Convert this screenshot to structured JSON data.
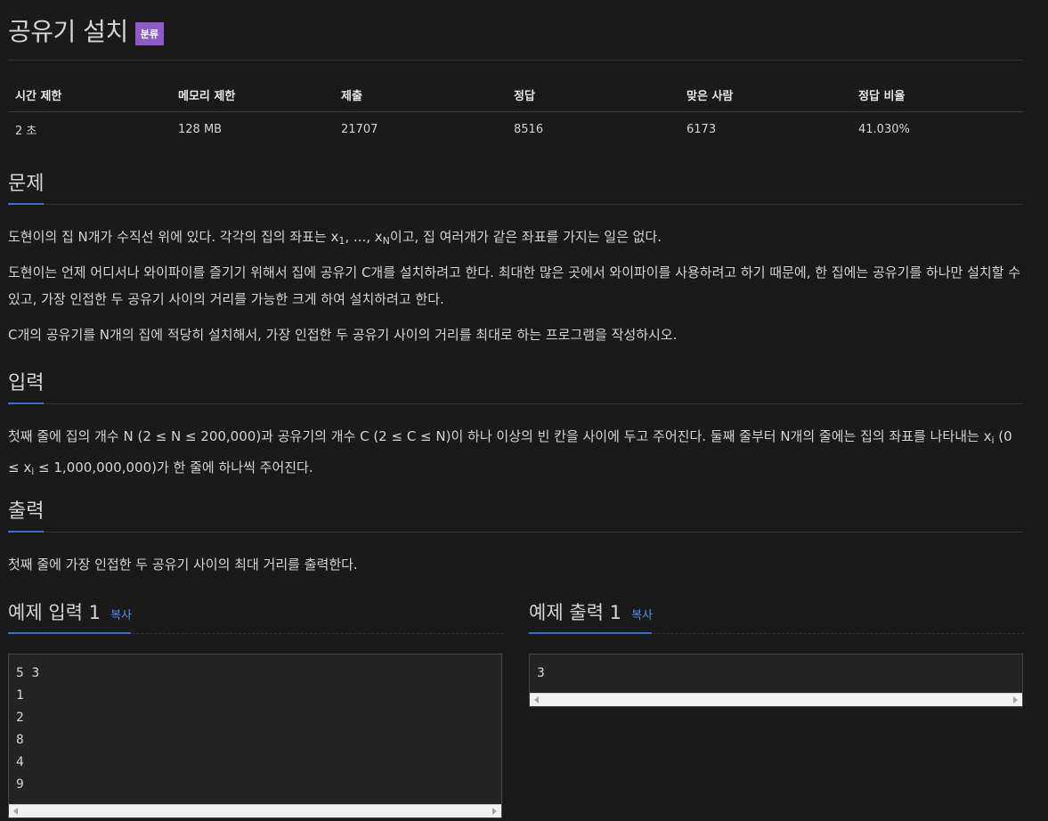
{
  "title": "공유기 설치",
  "badge": "분류",
  "info_table": {
    "headers": [
      "시간 제한",
      "메모리 제한",
      "제출",
      "정답",
      "맞은 사람",
      "정답 비율"
    ],
    "values": [
      "2 초",
      "128 MB",
      "21707",
      "8516",
      "6173",
      "41.030%"
    ]
  },
  "problem": {
    "heading": "문제",
    "p1_a": "도현이의 집 N개가 수직선 위에 있다. 각각의 집의 좌표는 x",
    "p1_sub1": "1",
    "p1_b": ", ..., x",
    "p1_sub2": "N",
    "p1_c": "이고, 집 여러개가 같은 좌표를 가지는 일은 없다.",
    "p2": "도현이는 언제 어디서나 와이파이를 즐기기 위해서 집에 공유기 C개를 설치하려고 한다. 최대한 많은 곳에서 와이파이를 사용하려고 하기 때문에, 한 집에는 공유기를 하나만 설치할 수 있고, 가장 인접한 두 공유기 사이의 거리를 가능한 크게 하여 설치하려고 한다.",
    "p3": "C개의 공유기를 N개의 집에 적당히 설치해서, 가장 인접한 두 공유기 사이의 거리를 최대로 하는 프로그램을 작성하시오."
  },
  "input": {
    "heading": "입력",
    "p_a": "첫째 줄에 집의 개수 N (2 ≤ N ≤ 200,000)과 공유기의 개수 C (2 ≤ C ≤ N)이 하나 이상의 빈 칸을 사이에 두고 주어진다. 둘째 줄부터 N개의 줄에는 집의 좌표를 나타내는 x",
    "p_sub1": "i",
    "p_b": " (0 ≤ x",
    "p_sub2": "i",
    "p_c": " ≤ 1,000,000,000)가 한 줄에 하나씩 주어진다."
  },
  "output": {
    "heading": "출력",
    "p": "첫째 줄에 가장 인접한 두 공유기 사이의 최대 거리를 출력한다."
  },
  "examples": {
    "input_heading": "예제 입력 1",
    "output_heading": "예제 출력 1",
    "copy_label": "복사",
    "input_lines": [
      "5 3",
      "1",
      "2",
      "8",
      "4",
      "9"
    ],
    "output_lines": [
      "3"
    ]
  }
}
